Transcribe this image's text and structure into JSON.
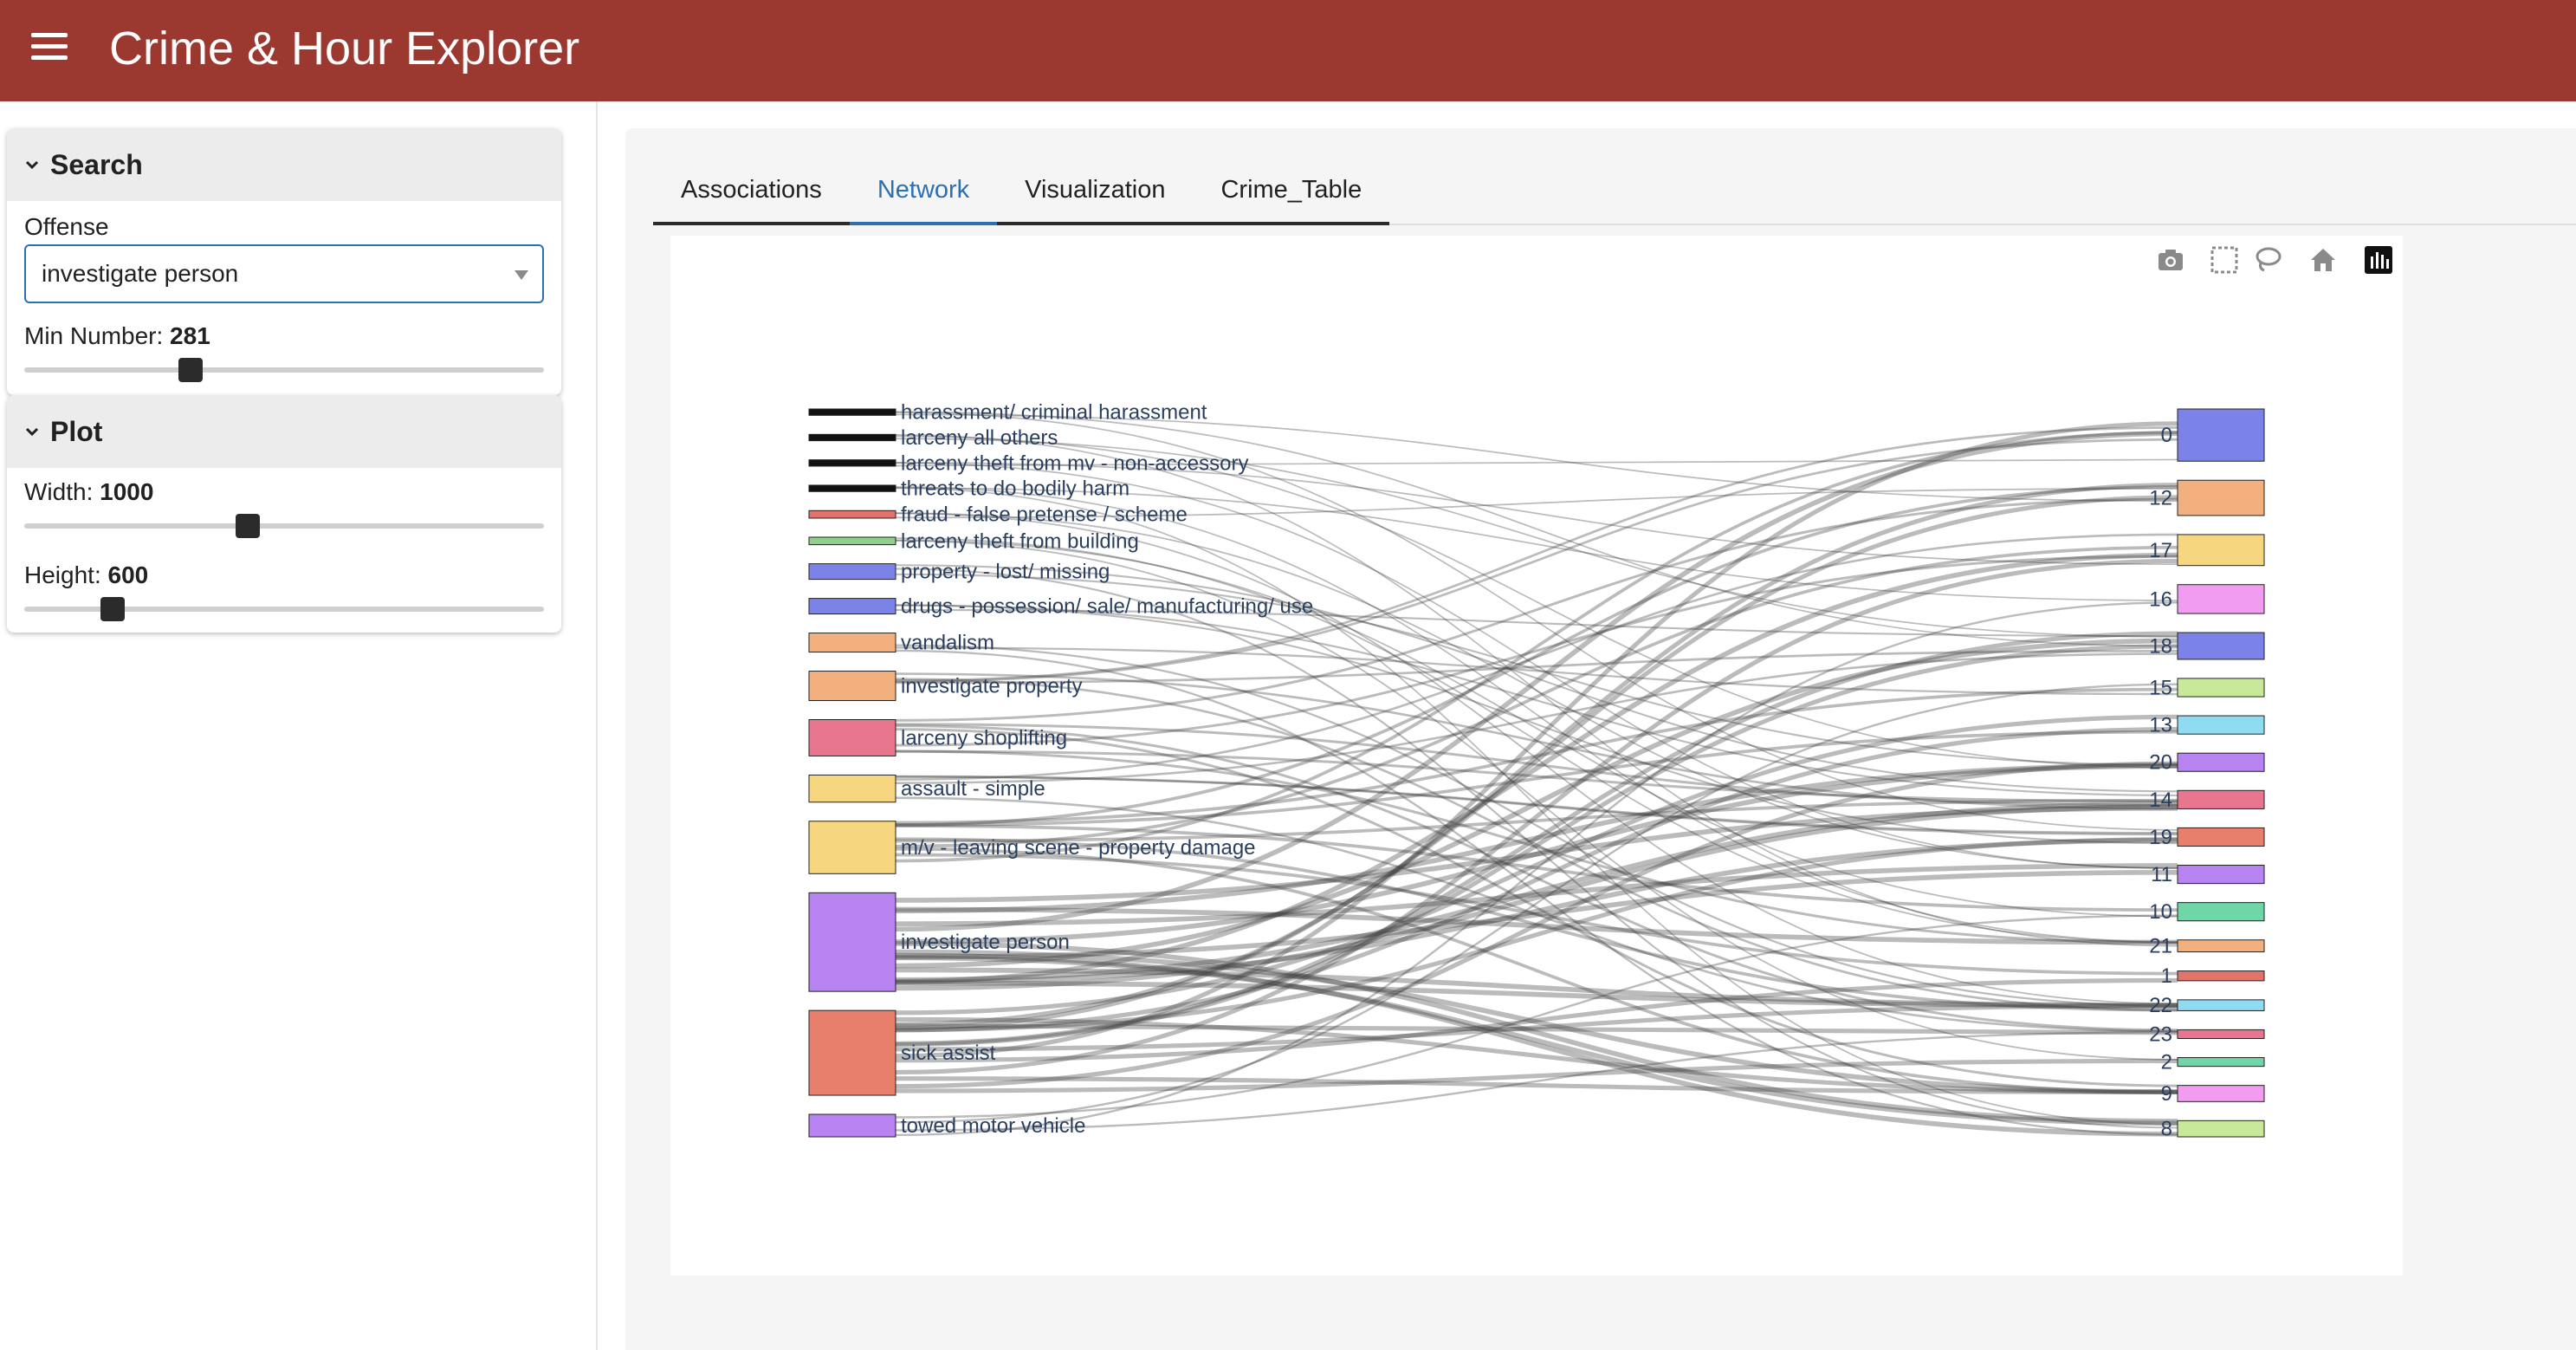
{
  "app": {
    "title": "Crime & Hour Explorer"
  },
  "sidebar": {
    "search": {
      "title": "Search",
      "offense_label": "Offense",
      "offense_value": "investigate person",
      "min_number_label": "Min Number:",
      "min_number_value": "281",
      "min_number_fraction": 0.32
    },
    "plot": {
      "title": "Plot",
      "width_label": "Width:",
      "width_value": "1000",
      "width_fraction": 0.43,
      "height_label": "Height:",
      "height_value": "600",
      "height_fraction": 0.17
    }
  },
  "tabs": [
    {
      "label": "Associations",
      "active": false
    },
    {
      "label": "Network",
      "active": true
    },
    {
      "label": "Visualization",
      "active": false
    },
    {
      "label": "Crime_Table",
      "active": false
    }
  ],
  "modebar": [
    "camera-icon",
    "box-select-icon",
    "lasso-icon",
    "home-icon",
    "plotly-logo-icon"
  ],
  "chart_data": {
    "type": "sankey",
    "source_nodes": [
      {
        "label": "harassment/ criminal harassment",
        "color": "#111111",
        "weight": 0.4
      },
      {
        "label": "larceny all others",
        "color": "#111111",
        "weight": 0.4
      },
      {
        "label": "larceny theft from mv - non-accessory",
        "color": "#111111",
        "weight": 0.4
      },
      {
        "label": "threats to do bodily harm",
        "color": "#111111",
        "weight": 0.4
      },
      {
        "label": "fraud - false pretense / scheme",
        "color": "#e0746a",
        "weight": 0.5
      },
      {
        "label": "larceny theft from building",
        "color": "#8fd08a",
        "weight": 0.5
      },
      {
        "label": "property - lost/ missing",
        "color": "#7b82e8",
        "weight": 1.2
      },
      {
        "label": "drugs - possession/ sale/ manufacturing/ use",
        "color": "#7b82e8",
        "weight": 1.2
      },
      {
        "label": "vandalism",
        "color": "#f2b07f",
        "weight": 1.5
      },
      {
        "label": "investigate property",
        "color": "#f2b07f",
        "weight": 2.4
      },
      {
        "label": "larceny shoplifting",
        "color": "#e8768e",
        "weight": 3.0
      },
      {
        "label": "assault - simple",
        "color": "#f6d77f",
        "weight": 2.2
      },
      {
        "label": "m/v - leaving scene - property damage",
        "color": "#f6d77f",
        "weight": 4.4
      },
      {
        "label": "investigate person",
        "color": "#b683f0",
        "weight": 8.4
      },
      {
        "label": "sick assist",
        "color": "#e87f6d",
        "weight": 7.2
      },
      {
        "label": "towed motor vehicle",
        "color": "#b683f0",
        "weight": 1.8
      }
    ],
    "target_nodes": [
      {
        "label": "0",
        "color": "#7b82e8",
        "weight": 4.6
      },
      {
        "label": "12",
        "color": "#f2b07f",
        "weight": 3.0
      },
      {
        "label": "17",
        "color": "#f6d77f",
        "weight": 2.6
      },
      {
        "label": "16",
        "color": "#f19cf0",
        "weight": 2.4
      },
      {
        "label": "18",
        "color": "#7b82e8",
        "weight": 2.2
      },
      {
        "label": "15",
        "color": "#c8e89a",
        "weight": 1.4
      },
      {
        "label": "13",
        "color": "#8fdcf2",
        "weight": 1.4
      },
      {
        "label": "20",
        "color": "#b683f0",
        "weight": 1.4
      },
      {
        "label": "14",
        "color": "#e8768e",
        "weight": 1.4
      },
      {
        "label": "19",
        "color": "#e87f6d",
        "weight": 1.4
      },
      {
        "label": "11",
        "color": "#b683f0",
        "weight": 1.4
      },
      {
        "label": "10",
        "color": "#6fd6a8",
        "weight": 1.4
      },
      {
        "label": "21",
        "color": "#f2b07f",
        "weight": 0.8
      },
      {
        "label": "1",
        "color": "#e0746a",
        "weight": 0.6
      },
      {
        "label": "22",
        "color": "#8fdcf2",
        "weight": 0.7
      },
      {
        "label": "23",
        "color": "#e8768e",
        "weight": 0.5
      },
      {
        "label": "2",
        "color": "#6fd6a8",
        "weight": 0.5
      },
      {
        "label": "9",
        "color": "#f19cf0",
        "weight": 1.2
      },
      {
        "label": "8",
        "color": "#c8e89a",
        "weight": 1.2
      }
    ]
  }
}
